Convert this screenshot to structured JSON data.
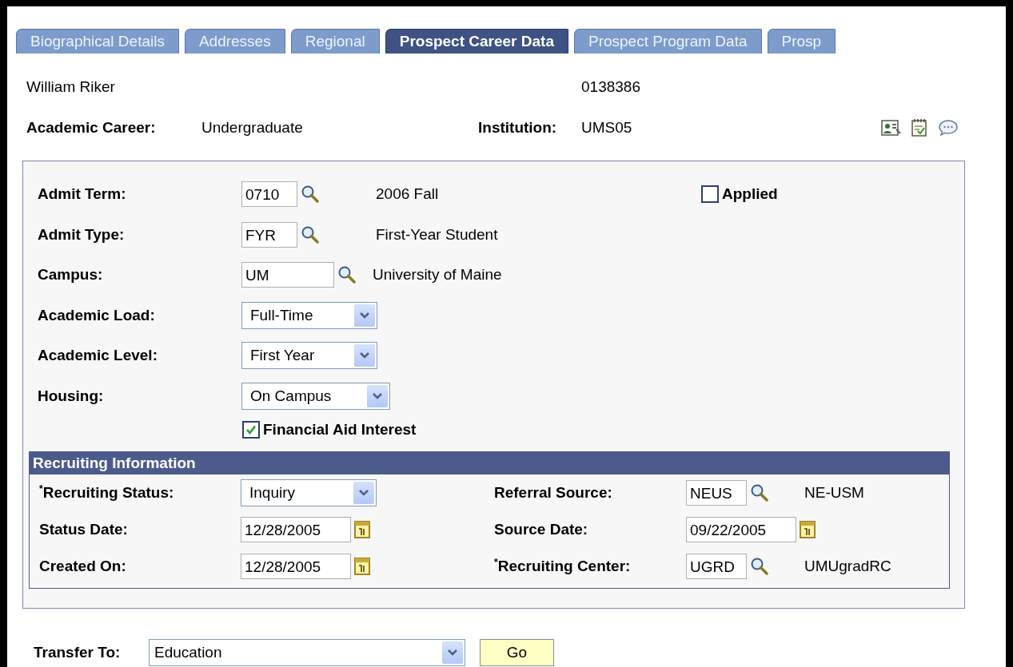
{
  "tabs": [
    {
      "label": "Biographical Details",
      "selected": false
    },
    {
      "label": "Addresses",
      "selected": false
    },
    {
      "label": "Regional",
      "selected": false
    },
    {
      "label": "Prospect Career Data",
      "selected": true
    },
    {
      "label": "Prospect Program Data",
      "selected": false
    },
    {
      "label": "Prosp",
      "selected": false
    }
  ],
  "header": {
    "name": "William Riker",
    "id": "0138386",
    "career_label": "Academic Career:",
    "career": "Undergraduate",
    "institution_label": "Institution:",
    "institution": "UMS05"
  },
  "form": {
    "fields": [
      {
        "kind": "lookup",
        "label": "Admit Term:",
        "value": "0710",
        "description": "2006 Fall"
      },
      {
        "kind": "lookup",
        "label": "Admit Type:",
        "value": "FYR",
        "description": "First-Year Student"
      },
      {
        "kind": "lookup",
        "label": "Campus:",
        "value": "UM",
        "description": "University of Maine",
        "wide": true
      },
      {
        "kind": "select",
        "label": "Academic Load:",
        "value": "Full-Time"
      },
      {
        "kind": "select",
        "label": "Academic Level:",
        "value": "First Year"
      },
      {
        "kind": "select",
        "label": "Housing:",
        "value": "On Campus",
        "wide": true
      }
    ],
    "applied": {
      "label": "Applied",
      "checked": false
    },
    "financial_aid": {
      "label": "Financial Aid Interest",
      "checked": true
    }
  },
  "recruiting": {
    "title": "Recruiting Information",
    "rows": [
      {
        "left": {
          "kind": "select",
          "label": "$^{*}$Recruiting Status:",
          "value": "Inquiry"
        },
        "right": {
          "kind": "lookup",
          "label": "Referral Source:",
          "value": "NEUS",
          "description": "NE-USM"
        }
      },
      {
        "left": {
          "kind": "date",
          "label": "Status Date:",
          "value": "12/28/2005"
        },
        "right": {
          "kind": "date",
          "label": "Source Date:",
          "value": "09/22/2005"
        }
      },
      {
        "left": {
          "kind": "date",
          "label": "Created On:",
          "value": "12/28/2005"
        },
        "right": {
          "kind": "lookup",
          "label": "$^{*}$Recruiting Center:",
          "value": "UGRD",
          "description": "UMUgradRC"
        }
      }
    ]
  },
  "transfer": {
    "label": "Transfer To:",
    "value": "Education",
    "button": "Go"
  }
}
